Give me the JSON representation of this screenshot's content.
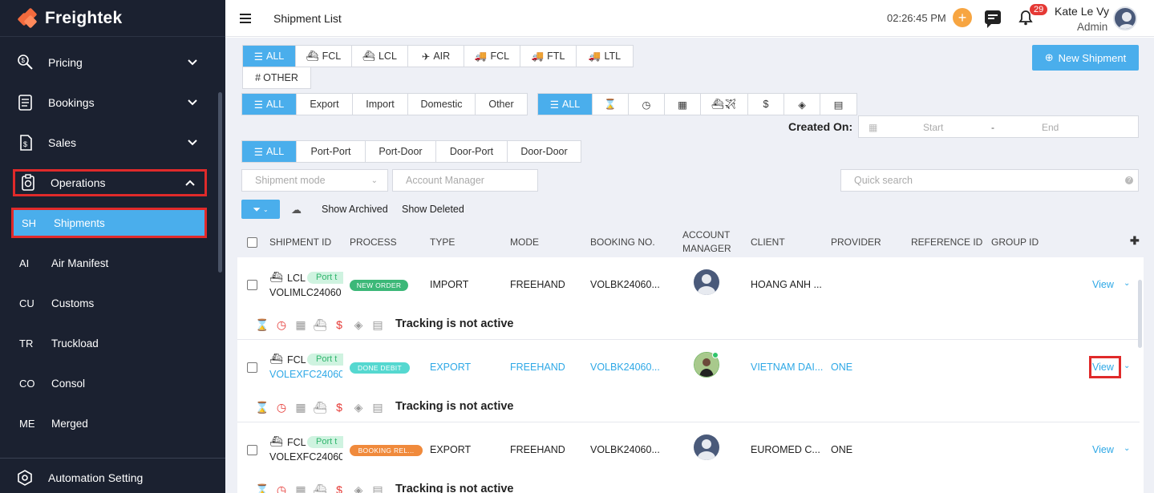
{
  "brand": {
    "name": "Freightek"
  },
  "sidebar": {
    "items": [
      {
        "label": "Pricing",
        "icon": "pricing-icon"
      },
      {
        "label": "Bookings",
        "icon": "bookings-icon"
      },
      {
        "label": "Sales",
        "icon": "sales-icon"
      },
      {
        "label": "Operations",
        "icon": "operations-icon"
      }
    ],
    "sub_items": [
      {
        "code": "SH",
        "label": "Shipments"
      },
      {
        "code": "AI",
        "label": "Air Manifest"
      },
      {
        "code": "CU",
        "label": "Customs"
      },
      {
        "code": "TR",
        "label": "Truckload"
      },
      {
        "code": "CO",
        "label": "Consol"
      },
      {
        "code": "ME",
        "label": "Merged"
      }
    ],
    "footer_item": "Automation Setting"
  },
  "topbar": {
    "title": "Shipment List",
    "time": "02:26:45 PM",
    "notifications": "29",
    "user_name": "Kate Le Vy",
    "user_role": "Admin"
  },
  "filters": {
    "mode_tabs": [
      "ALL",
      "FCL",
      "LCL",
      "AIR",
      "FCL",
      "FTL",
      "LTL"
    ],
    "other_tab": "OTHER",
    "type_tabs": [
      "ALL",
      "Export",
      "Import",
      "Domestic",
      "Other"
    ],
    "status_tabs_all": "ALL",
    "status_tab_icons": [
      "hourglass-icon",
      "clock-icon",
      "calendar-icon",
      "ship-plane-icon",
      "dollar-icon",
      "tag-icon",
      "document-icon"
    ],
    "route_tabs": [
      "ALL",
      "Port-Port",
      "Port-Door",
      "Door-Port",
      "Door-Door"
    ],
    "created_on_label": "Created On:",
    "date_start_placeholder": "Start",
    "date_separator": "-",
    "date_end_placeholder": "End",
    "shipment_mode_placeholder": "Shipment mode",
    "account_manager_placeholder": "Account Manager",
    "quick_search_placeholder": "Quick search",
    "show_archived": "Show Archived",
    "show_deleted": "Show Deleted",
    "new_shipment": "New Shipment"
  },
  "table": {
    "columns": [
      "SHIPMENT ID",
      "PROCESS",
      "TYPE",
      "MODE",
      "BOOKING NO.",
      "ACCOUNT",
      "MANAGER",
      "CLIENT",
      "PROVIDER",
      "REFERENCE ID",
      "GROUP ID"
    ],
    "rows": [
      {
        "mode": "LCL",
        "tag": "Port t",
        "id": "VOLIMLC24060",
        "process": "NEW ORDER",
        "process_color": "#3cb878",
        "type": "IMPORT",
        "ship_mode": "FREEHAND",
        "booking": "VOLBK24060...",
        "client": "HOANG ANH ...",
        "provider": "",
        "view": "View",
        "tracking": "Tracking is not active",
        "linked": false
      },
      {
        "mode": "FCL",
        "tag": "Port t",
        "id": "VOLEXFC24060",
        "process": "DONE DEBIT",
        "process_color": "#55d8d0",
        "type": "EXPORT",
        "ship_mode": "FREEHAND",
        "booking": "VOLBK24060...",
        "client": "VIETNAM DAI...",
        "provider": "ONE",
        "view": "View",
        "tracking": "Tracking is not active",
        "linked": true
      },
      {
        "mode": "FCL",
        "tag": "Port t",
        "id": "VOLEXFC24060",
        "process": "BOOKING REL...",
        "process_color": "#f08a3c",
        "type": "EXPORT",
        "ship_mode": "FREEHAND",
        "booking": "VOLBK24060...",
        "client": "EUROMED C...",
        "provider": "ONE",
        "view": "View",
        "tracking": "Tracking is not active",
        "linked": false
      }
    ]
  },
  "colors": {
    "accent": "#4aaeec",
    "sidebar_bg": "#1b2130",
    "highlight": "#e02a2a"
  }
}
